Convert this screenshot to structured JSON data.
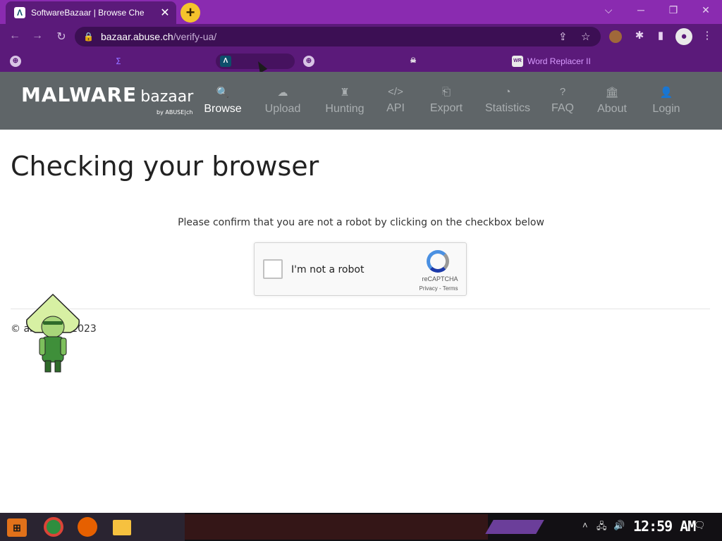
{
  "browser": {
    "tab": {
      "title": "SoftwareBazaar | Browse Che",
      "logo_glyph": "Λ",
      "close_glyph": "✕"
    },
    "new_tab_glyph": "+",
    "window_controls": {
      "dropdown": "⌵",
      "minimize": "─",
      "restore": "❐",
      "close": "✕"
    },
    "nav": {
      "back": "←",
      "forward": "→",
      "reload": "↻"
    },
    "address": {
      "lock_glyph": "🔒",
      "host": "bazaar.abuse.ch",
      "path": "/verify-ua/"
    },
    "toolbar_icons": {
      "share": "⇪",
      "star": "☆",
      "extensions": "✱",
      "side_panel": "▮",
      "profile": "●",
      "menu": "⋮"
    },
    "bookmarks": [
      {
        "label": "",
        "icon": "⊕",
        "icon_name": "globe-icon"
      },
      {
        "label": "",
        "icon": "∑",
        "icon_name": "sigma-icon"
      },
      {
        "label": "",
        "icon": "Λ",
        "icon_name": "bazaar-icon"
      },
      {
        "label": "",
        "icon": "⊕",
        "icon_name": "globe-icon"
      },
      {
        "label": "",
        "icon": "☠",
        "icon_name": "skull-icon"
      },
      {
        "label": "Word Replacer II",
        "icon": "WR",
        "icon_name": "word-replacer-icon"
      }
    ]
  },
  "site": {
    "brand_main": "MALWARE",
    "brand_sub": "bazaar",
    "brand_by": "by ABUSE|ch",
    "nav": [
      {
        "label": "Browse",
        "icon": "🔍",
        "active": true
      },
      {
        "label": "Upload",
        "icon": "☁",
        "active": false
      },
      {
        "label": "Hunting",
        "icon": "♜",
        "active": false
      },
      {
        "label": "API",
        "icon": "</>",
        "active": false
      },
      {
        "label": "Export",
        "icon": "⎗",
        "active": false
      },
      {
        "label": "Statistics",
        "icon": "◔",
        "active": false
      },
      {
        "label": "FAQ",
        "icon": "?",
        "active": false
      },
      {
        "label": "About",
        "icon": "🏛",
        "active": false
      },
      {
        "label": "Login",
        "icon": "👤",
        "active": false
      }
    ],
    "heading": "Checking your browser",
    "prompt": "Please confirm that you are not a robot by clicking on the checkbox below",
    "captcha": {
      "label": "I'm not a robot",
      "brand": "reCAPTCHA",
      "links": "Privacy - Terms"
    },
    "footer": "© abuse.ch 2023"
  },
  "taskbar": {
    "start_glyph": "⊞",
    "apps": [
      "chrome",
      "firefox",
      "files"
    ],
    "tray_icons": {
      "chevron": "˄",
      "network": "🖧",
      "volume": "🔊",
      "notifications": "🗨"
    },
    "clock": "12:59 AM"
  },
  "colors": {
    "tab_bar": "#8a2bb0",
    "toolbar": "#5b1a7a",
    "site_nav": "#5f6568",
    "bookmark_text": "#d89bff"
  }
}
